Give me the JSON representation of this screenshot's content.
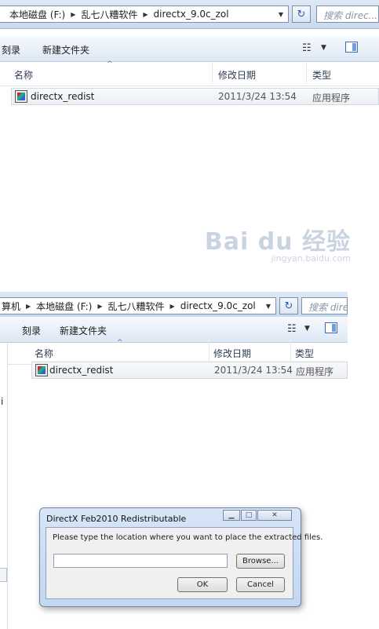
{
  "panel1": {
    "breadcrumb": [
      "本地磁盘 (F:)",
      "乱七八糟软件",
      "directx_9.0c_zol"
    ],
    "search_placeholder": "搜索 direc...",
    "toolbar": {
      "burn": "刻录",
      "new_folder": "新建文件夹"
    },
    "columns": {
      "name": "名称",
      "date": "修改日期",
      "type": "类型"
    },
    "file": {
      "name": "directx_redist",
      "date": "2011/3/24 13:54",
      "type": "应用程序"
    },
    "watermark": {
      "logo": "Bai du 经验",
      "sub": "jingyan.baidu.com"
    }
  },
  "panel2": {
    "breadcrumb": [
      "算机",
      "本地磁盘 (F:)",
      "乱七八糟软件",
      "directx_9.0c_zol"
    ],
    "search_placeholder": "搜索 direc",
    "toolbar": {
      "burn": "刻录",
      "new_folder": "新建文件夹"
    },
    "columns": {
      "name": "名称",
      "date": "修改日期",
      "type": "类型"
    },
    "file": {
      "name": "directx_redist",
      "date": "2011/3/24 13:54",
      "type": "应用程序"
    },
    "nav_char": "i"
  },
  "dialog": {
    "title": "DirectX Feb2010 Redistributable",
    "prompt": "Please type the location where you want to place the extracted files.",
    "path_value": "",
    "browse": "Browse...",
    "ok": "OK",
    "cancel": "Cancel",
    "close_glyph": "✕"
  },
  "icons": {
    "dropdown": "chevron-down-icon",
    "separator": "triangle-right-icon",
    "refresh": "refresh-icon",
    "views": "views-icon",
    "preview": "preview-pane-icon",
    "app": "application-icon"
  }
}
